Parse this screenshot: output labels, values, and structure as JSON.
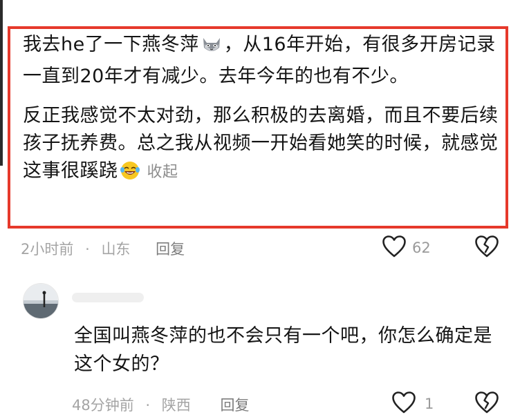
{
  "comment_1": {
    "para_1a": "我去he了一下燕冬萍",
    "para_1b": "，从16年开始，有很多开房记录一直到20年才有减少。去年今年的也有不少。",
    "para_2": "反正我感觉不太对劲，那么积极的去离婚，而且不要后续孩子抚养费。总之我从视频一开始看她笑的时候，就感觉这事很蹊跷",
    "collapse_label": "收起",
    "emoji_1": "cat-emoji-icon",
    "emoji_2": "laughing-tears-emoji-icon",
    "time": "2小时前",
    "separator": "·",
    "location": "山东",
    "reply_label": "回复",
    "like_count": "62",
    "highlight_color": "#e6392b"
  },
  "comment_2": {
    "avatar_icon": "avatar-icon",
    "text": "全国叫燕冬萍的也不会只有一个吧，你怎么确定是这个女的？",
    "time": "48分钟前",
    "separator": "·",
    "location": "陕西",
    "reply_label": "回复",
    "like_count": "1"
  },
  "icons": {
    "like": "heart-outline-icon",
    "dislike": "broken-heart-icon"
  }
}
